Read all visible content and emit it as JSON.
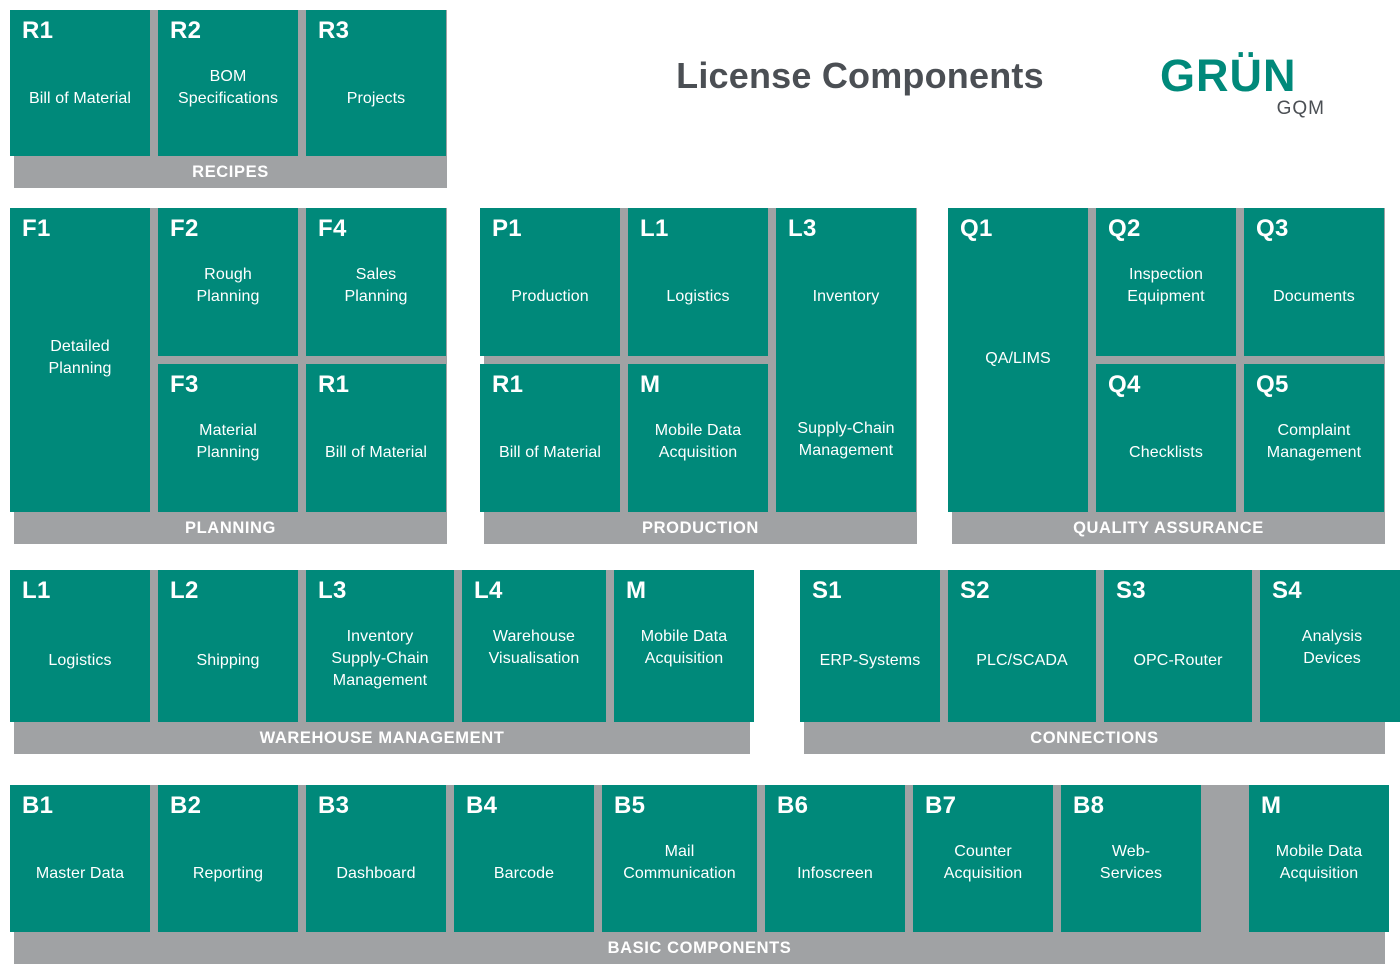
{
  "header": {
    "title": "License Components",
    "logo_main": "GRÜN",
    "logo_sub": "GQM"
  },
  "colors": {
    "teal": "#00897A",
    "gray": "#A0A2A4",
    "title_gray": "#4B4F54",
    "white": "#FFFFFF"
  },
  "groups": [
    {
      "id": "recipes",
      "label": "RECIPES",
      "cards": [
        {
          "code": "R1",
          "name": "Bill of Material"
        },
        {
          "code": "R2",
          "name": "BOM\nSpecifications"
        },
        {
          "code": "R3",
          "name": "Projects"
        }
      ]
    },
    {
      "id": "planning",
      "label": "PLANNING",
      "cards": [
        {
          "code": "F1",
          "name": "Detailed\nPlanning"
        },
        {
          "code": "F2",
          "name": "Rough\nPlanning"
        },
        {
          "code": "F4",
          "name": "Sales\nPlanning"
        },
        {
          "code": "F3",
          "name": "Material\nPlanning"
        },
        {
          "code": "R1",
          "name": "Bill of Material"
        }
      ]
    },
    {
      "id": "production",
      "label": "PRODUCTION",
      "cards": [
        {
          "code": "P1",
          "name": "Production"
        },
        {
          "code": "L1",
          "name": "Logistics"
        },
        {
          "code": "L3",
          "name": "Inventory",
          "name2": "Supply-Chain\nManagement"
        },
        {
          "code": "R1",
          "name": "Bill of Material"
        },
        {
          "code": "M",
          "name": "Mobile Data\nAcquisition"
        }
      ]
    },
    {
      "id": "quality-assurance",
      "label": "QUALITY ASSURANCE",
      "cards": [
        {
          "code": "Q1",
          "name": "QA/LIMS"
        },
        {
          "code": "Q2",
          "name": "Inspection\nEquipment"
        },
        {
          "code": "Q3",
          "name": "Documents"
        },
        {
          "code": "Q4",
          "name": "Checklists"
        },
        {
          "code": "Q5",
          "name": "Complaint\nManagement"
        }
      ]
    },
    {
      "id": "warehouse-management",
      "label": "WAREHOUSE MANAGEMENT",
      "cards": [
        {
          "code": "L1",
          "name": "Logistics"
        },
        {
          "code": "L2",
          "name": "Shipping"
        },
        {
          "code": "L3",
          "name": "Inventory\nSupply-Chain\nManagement"
        },
        {
          "code": "L4",
          "name": "Warehouse\nVisualisation"
        },
        {
          "code": "M",
          "name": "Mobile Data\nAcquisition"
        }
      ]
    },
    {
      "id": "connections",
      "label": "CONNECTIONS",
      "cards": [
        {
          "code": "S1",
          "name": "ERP-Systems"
        },
        {
          "code": "S2",
          "name": "PLC/SCADA"
        },
        {
          "code": "S3",
          "name": "OPC-Router"
        },
        {
          "code": "S4",
          "name": "Analysis\nDevices"
        }
      ]
    },
    {
      "id": "basic-components",
      "label": "BASIC COMPONENTS",
      "cards": [
        {
          "code": "B1",
          "name": "Master Data"
        },
        {
          "code": "B2",
          "name": "Reporting"
        },
        {
          "code": "B3",
          "name": "Dashboard"
        },
        {
          "code": "B4",
          "name": "Barcode"
        },
        {
          "code": "B5",
          "name": "Mail\nCommunication"
        },
        {
          "code": "B6",
          "name": "Infoscreen"
        },
        {
          "code": "B7",
          "name": "Counter\nAcquisition"
        },
        {
          "code": "B8",
          "name": "Web-\nServices"
        },
        {
          "code": "M",
          "name": "Mobile Data\nAcquisition"
        }
      ]
    }
  ]
}
